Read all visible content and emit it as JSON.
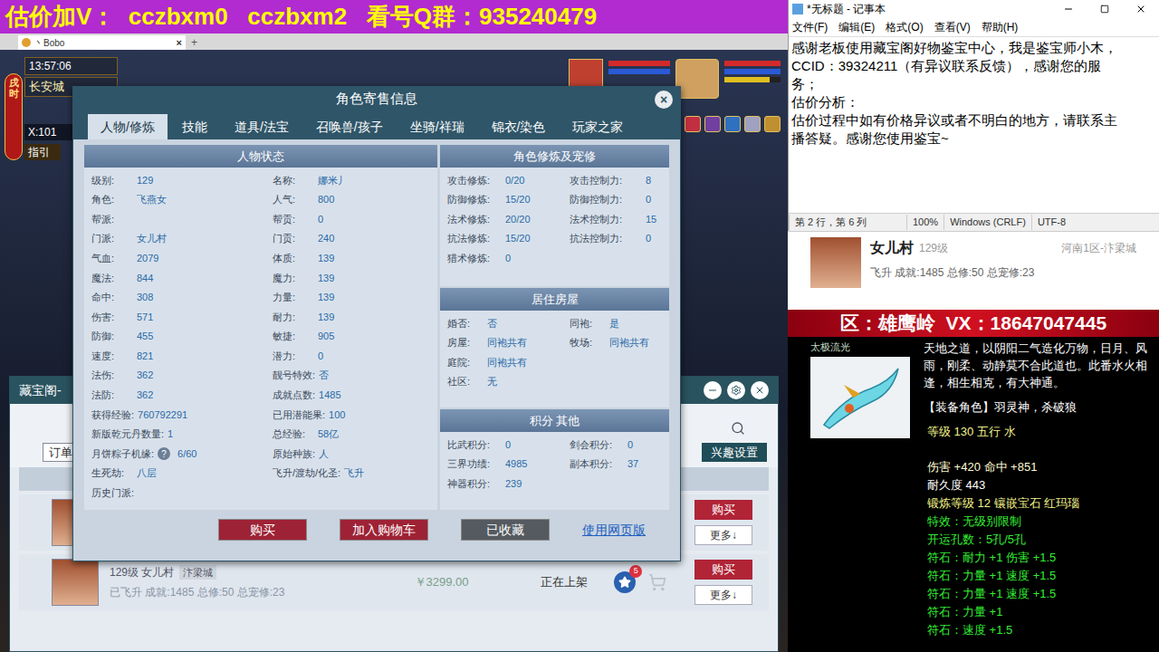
{
  "banner": "估价加V：  cczbxm0   cczbxm2   看号Q群：935240479",
  "browser_tab": {
    "title": "丶Bobo",
    "close": "×",
    "new": "+"
  },
  "hud": {
    "time": "13:57:06",
    "map": "长安城",
    "hour": "戌时",
    "coords": "X:101",
    "guide": "指引",
    "bars": [
      {
        "color": "#d42a2a",
        "level": 1
      },
      {
        "color": "#2a5ad4",
        "level": 1
      },
      {
        "color": "#d42a2a",
        "level": 1
      },
      {
        "color": "#2a5ad4",
        "level": 1
      },
      {
        "color": "#e0c020",
        "level": 0.8
      }
    ]
  },
  "dialog": {
    "title": "角色寄售信息",
    "close": "×",
    "tabs": [
      {
        "label": "人物/修炼",
        "selected": true
      },
      {
        "label": "技能",
        "selected": false
      },
      {
        "label": "道具/法宝",
        "selected": false
      },
      {
        "label": "召唤兽/孩子",
        "selected": false
      },
      {
        "label": "坐骑/祥瑞",
        "selected": false
      },
      {
        "label": "锦衣/染色",
        "selected": false
      },
      {
        "label": "玩家之家",
        "selected": false
      }
    ],
    "status": {
      "title": "人物状态",
      "rows": [
        [
          {
            "label": "级别:",
            "value": "129"
          },
          {
            "label": "名称:",
            "value": "娜米丿"
          }
        ],
        [
          {
            "label": "角色:",
            "value": "飞燕女"
          },
          {
            "label": "人气:",
            "value": "800"
          }
        ],
        [
          {
            "label": "帮派:",
            "value": ""
          },
          {
            "label": "帮贡:",
            "value": "0"
          }
        ],
        [
          {
            "label": "门派:",
            "value": "女儿村"
          },
          {
            "label": "门贡:",
            "value": "240"
          }
        ],
        [
          {
            "label": "气血:",
            "value": "2079"
          },
          {
            "label": "体质:",
            "value": "139"
          }
        ],
        [
          {
            "label": "魔法:",
            "value": "844"
          },
          {
            "label": "魔力:",
            "value": "139"
          }
        ],
        [
          {
            "label": "命中:",
            "value": "308"
          },
          {
            "label": "力量:",
            "value": "139"
          }
        ],
        [
          {
            "label": "伤害:",
            "value": "571"
          },
          {
            "label": "耐力:",
            "value": "139"
          }
        ],
        [
          {
            "label": "防御:",
            "value": "455"
          },
          {
            "label": "敏捷:",
            "value": "905"
          }
        ],
        [
          {
            "label": "速度:",
            "value": "821"
          },
          {
            "label": "潜力:",
            "value": "0"
          }
        ],
        [
          {
            "label": "法伤:",
            "value": "362"
          },
          {
            "label": "靓号特效:",
            "value": "否"
          }
        ],
        [
          {
            "label": "法防:",
            "value": "362"
          },
          {
            "label": "成就点数:",
            "value": "1485"
          }
        ],
        [
          {
            "label": "获得经验:",
            "value": "760792291"
          },
          {
            "label": "已用潜能果:",
            "value": "100"
          }
        ],
        [
          {
            "label": "新版乾元丹数量:",
            "value": "1"
          },
          {
            "label": "总经验:",
            "value": "58亿"
          }
        ],
        [
          {
            "label": "月饼粽子机缘:",
            "value": "6/60",
            "help": "?"
          },
          {
            "label": "原始种族:",
            "value": "人"
          }
        ],
        [
          {
            "label": "生死劫:",
            "value": "八层"
          },
          {
            "label": "飞升/渡劫/化圣:",
            "value": "飞升"
          }
        ],
        [
          {
            "label": "历史门派:",
            "value": ""
          }
        ]
      ]
    },
    "cultivation": {
      "title": "角色修炼及宠修",
      "rows": [
        [
          {
            "label": "攻击修炼:",
            "value": "0/20"
          },
          {
            "label": "攻击控制力:",
            "value": "8"
          }
        ],
        [
          {
            "label": "防御修炼:",
            "value": "15/20"
          },
          {
            "label": "防御控制力:",
            "value": "0"
          }
        ],
        [
          {
            "label": "法术修炼:",
            "value": "20/20"
          },
          {
            "label": "法术控制力:",
            "value": "15"
          }
        ],
        [
          {
            "label": "抗法修炼:",
            "value": "15/20"
          },
          {
            "label": "抗法控制力:",
            "value": "0"
          }
        ],
        [
          {
            "label": "猎术修炼:",
            "value": "0"
          }
        ]
      ]
    },
    "house": {
      "title": "居住房屋",
      "rows": [
        [
          {
            "label": "婚否:",
            "value": "否"
          },
          {
            "label": "同袍:",
            "value": "是"
          }
        ],
        [
          {
            "label": "房屋:",
            "value": "同袍共有"
          },
          {
            "label": "牧场:",
            "value": "同袍共有"
          }
        ],
        [
          {
            "label": "庭院:",
            "value": "同袍共有"
          }
        ],
        [
          {
            "label": "社区:",
            "value": "无"
          }
        ]
      ]
    },
    "scores": {
      "title": "积分 其他",
      "rows": [
        [
          {
            "label": "比武积分:",
            "value": "0"
          },
          {
            "label": "剑会积分:",
            "value": "0"
          }
        ],
        [
          {
            "label": "三界功绩:",
            "value": "4985"
          },
          {
            "label": "副本积分:",
            "value": "37"
          }
        ],
        [
          {
            "label": "神器积分:",
            "value": "239"
          }
        ]
      ]
    },
    "buttons": [
      {
        "label": "购买",
        "kind": "primary"
      },
      {
        "label": "加入购物车",
        "kind": "primary"
      },
      {
        "label": "已收藏",
        "kind": "dark"
      },
      {
        "label": "使用网页版",
        "kind": "link"
      }
    ]
  },
  "cbg": {
    "title": "藏宝阁-",
    "order_tab": "订单",
    "interest_button": "兴趣设置",
    "rows": [
      {
        "title": "",
        "server": "",
        "info": "",
        "price": "",
        "status": "",
        "favorites": "",
        "buy": "购买",
        "more": "更多↓"
      },
      {
        "title": "129级 女儿村",
        "server": "汴梁城",
        "info": "已飞升 成就:1485 总修:50 总宠修:23",
        "price": "￥3299.00",
        "status": "正在上架",
        "favorites": "5",
        "buy": "购买",
        "more": "更多↓"
      }
    ]
  },
  "notepad": {
    "title": "*无标题 - 记事本",
    "menu": [
      "文件(F)",
      "编辑(E)",
      "格式(O)",
      "查看(V)",
      "帮助(H)"
    ],
    "lines": [
      "感谢老板使用藏宝阁好物鉴宝中心，我是鉴宝师小木，",
      "CCID：39324211（有异议联系反馈），感谢您的服",
      "务；",
      "估价分析：",
      "估价过程中如有价格异议或者不明白的地方，请联系主",
      "播答疑。感谢您使用鉴宝~"
    ],
    "status": [
      "第 2 行，第 6 列",
      "100%",
      "Windows (CRLF)",
      "UTF-8"
    ]
  },
  "listing": {
    "school": "女儿村",
    "level": "129级",
    "server": "河南1区-汴梁城",
    "info": "飞升 成就:1485 总修:50 总宠修:23"
  },
  "item": {
    "banner": "区：雄鹰岭  VX：18647047445",
    "name": "太极流光",
    "description": "天地之道，以阴阳二气造化万物，日月、风雨，刚柔、动静莫不合此道也。此番水火相逢，相生相克，有大神通。",
    "equip": "【装备角色】羽灵神，杀破狼",
    "lines": [
      {
        "text": "等级 130  五行 水",
        "kind": "header",
        "color": "#f4f48a"
      },
      {
        "text": "伤害 +420  命中 +851",
        "kind": "stat",
        "color": "#fffbd0"
      },
      {
        "text": "耐久度 443",
        "kind": "stat",
        "color": "#ffffff"
      },
      {
        "text": "锻炼等级 12  镶嵌宝石 红玛瑙",
        "kind": "stat",
        "color": "#f4f48a"
      },
      {
        "text": "特效：无级别限制",
        "kind": "stat",
        "color": "#33ee33"
      },
      {
        "text": "开运孔数：5孔/5孔",
        "kind": "stat",
        "color": "#33ee33"
      },
      {
        "text": "符石：耐力 +1 伤害 +1.5",
        "kind": "stat",
        "color": "#33ee33"
      },
      {
        "text": "符石：力量 +1 速度 +1.5",
        "kind": "stat",
        "color": "#33ee33"
      },
      {
        "text": "符石：力量 +1 速度 +1.5",
        "kind": "stat",
        "color": "#33ee33"
      },
      {
        "text": "符石：力量 +1",
        "kind": "stat",
        "color": "#33ee33"
      },
      {
        "text": "符石：速度 +1.5",
        "kind": "stat",
        "color": "#33ee33"
      }
    ]
  }
}
